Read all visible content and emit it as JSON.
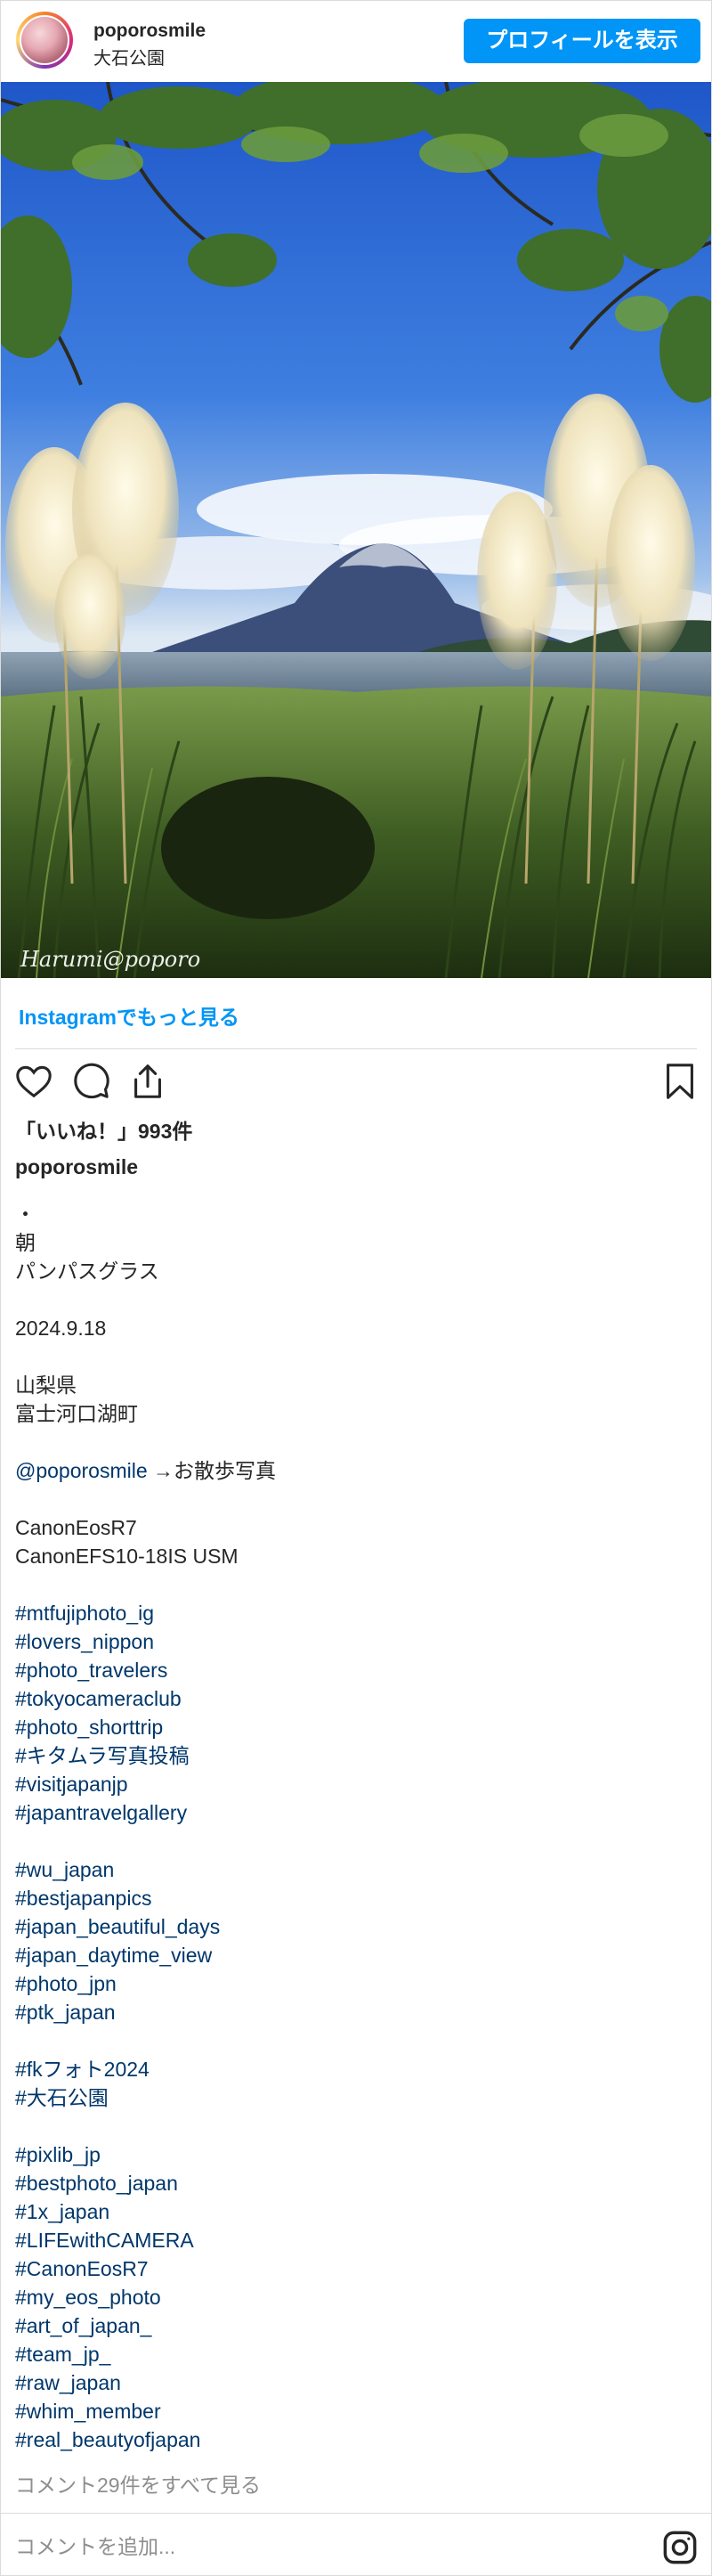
{
  "header": {
    "username": "poporosmile",
    "location": "大石公園",
    "profile_button": "プロフィールを表示"
  },
  "photo": {
    "watermark": "Harumi@poporo",
    "alt_icon": "photo"
  },
  "see_more": "Instagramでもっと見る",
  "actions": {
    "like_icon": "heart-icon",
    "comment_icon": "comment-icon",
    "share_icon": "share-icon",
    "save_icon": "bookmark-icon"
  },
  "likes": "「いいね！」993件",
  "caption": {
    "username": "poporosmile",
    "lines": [
      "・",
      "朝",
      "パンパスグラス",
      "",
      "2024.9.18",
      "",
      "山梨県",
      "富士河口湖町",
      "",
      "@poporosmile",
      "",
      "CanonEosR7",
      "CanonEFS10-18IS USM",
      "",
      "#mtfujiphoto_ig",
      "#lovers_nippon",
      "#photo_travelers",
      "#tokyocameraclub",
      "#photo_shorttrip",
      "#キタムラ写真投稿",
      "#visitjapanjp",
      "#japantravelgallery",
      "",
      "#wu_japan",
      "#bestjapanpics",
      "#japan_beautiful_days",
      "#japan_daytime_view",
      "#photo_jpn",
      "#ptk_japan",
      "",
      "#fkフォト2024",
      "#大石公園",
      "",
      "#pixlib_jp",
      "#bestphoto_japan",
      "#1x_japan",
      "#LIFEwithCAMERA",
      "#CanonEosR7",
      "#my_eos_photo",
      "#art_of_japan_",
      "#team_jp_",
      "#raw_japan",
      "#whim_member",
      "#real_beautyofjapan"
    ],
    "mention_suffix": " →お散歩写真"
  },
  "view_comments": "コメント29件をすべて見る",
  "comment_placeholder": "コメントを追加...",
  "colors": {
    "accent": "#0095f6",
    "link": "#00376b",
    "muted": "#8e8e8e",
    "border": "#dbdbdb"
  }
}
